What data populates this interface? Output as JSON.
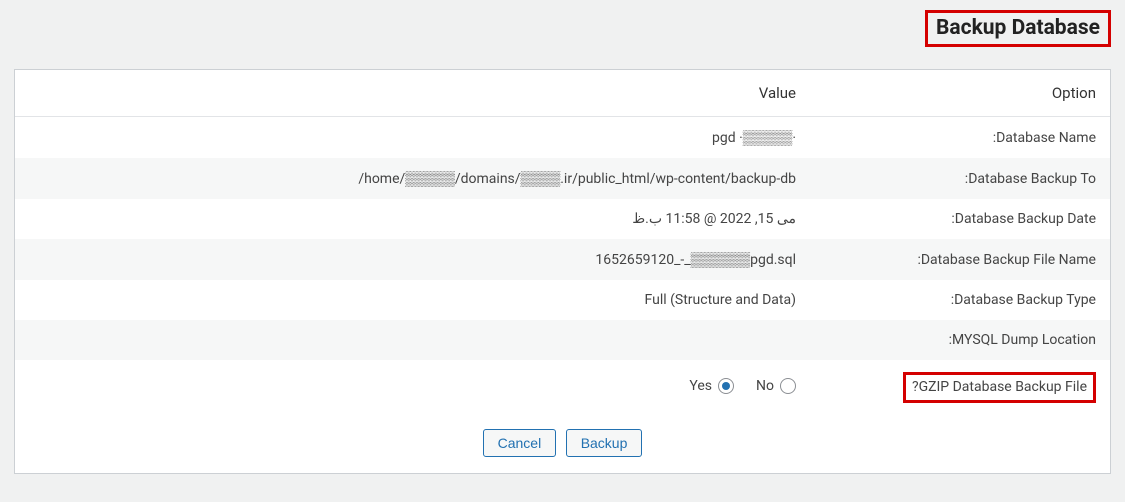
{
  "page_title": "Backup Database",
  "headers": {
    "value": "Value",
    "option": "Option"
  },
  "rows": {
    "db_name": {
      "label": ":Database Name",
      "value": "pgd ·▒▒▒▒▒·"
    },
    "backup_to": {
      "label": ":Database Backup To",
      "value": "/home/▒▒▒▒▒/domains/▒▒▒▒.ir/public_html/wp-content/backup-db"
    },
    "backup_date": {
      "label": ":Database Backup Date",
      "value": "می 15, 2022 @ 11:58 ب.ظ"
    },
    "file_name": {
      "label": ":Database Backup File Name",
      "value": "1652659120_-_▒▒▒▒▒▒pgd.sql"
    },
    "backup_type": {
      "label": ":Database Backup Type",
      "value": "Full (Structure and Data)"
    },
    "dump_loc": {
      "label": ":MYSQL Dump Location",
      "value": ""
    },
    "gzip": {
      "label": "?GZIP Database Backup File",
      "no_label": "No",
      "yes_label": "Yes"
    }
  },
  "buttons": {
    "cancel": "Cancel",
    "backup": "Backup"
  }
}
